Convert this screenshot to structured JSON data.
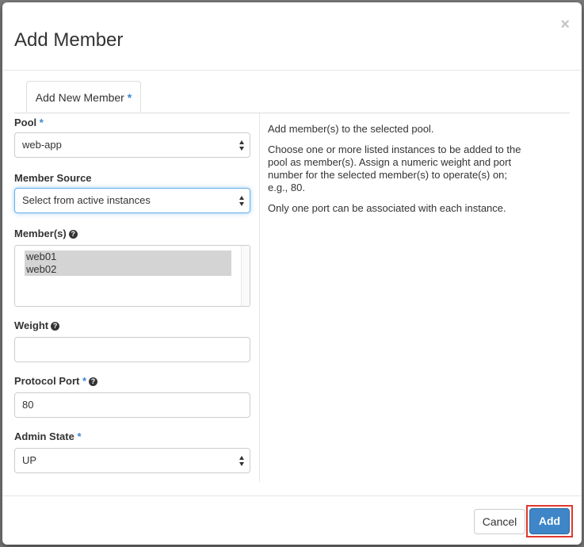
{
  "modal": {
    "title": "Add Member",
    "close_symbol": "×"
  },
  "tabs": [
    {
      "label": "Add New Member",
      "required_mark": "*"
    }
  ],
  "form": {
    "pool": {
      "label": "Pool",
      "required_mark": "*",
      "value": "web-app"
    },
    "member_source": {
      "label": "Member Source",
      "value": "Select from active instances"
    },
    "members": {
      "label": "Member(s)",
      "help_icon": "question-circle-icon",
      "items": [
        "web01",
        "web02"
      ]
    },
    "weight": {
      "label": "Weight",
      "help_icon": "question-circle-icon",
      "value": ""
    },
    "protocol_port": {
      "label": "Protocol Port",
      "required_mark": "*",
      "help_icon": "question-circle-icon",
      "value": "80"
    },
    "admin_state": {
      "label": "Admin State",
      "required_mark": "*",
      "value": "UP"
    }
  },
  "help_text": {
    "p1": "Add member(s) to the selected pool.",
    "p2": "Choose one or more listed instances to be added to the pool as member(s). Assign a numeric weight and port number for the selected member(s) to operate(s) on; e.g., 80.",
    "p3": "Only one port can be associated with each instance."
  },
  "footer": {
    "cancel_label": "Cancel",
    "add_label": "Add"
  },
  "colors": {
    "primary": "#3f86c8",
    "required": "#3a87cf",
    "highlight": "#e0382e"
  }
}
